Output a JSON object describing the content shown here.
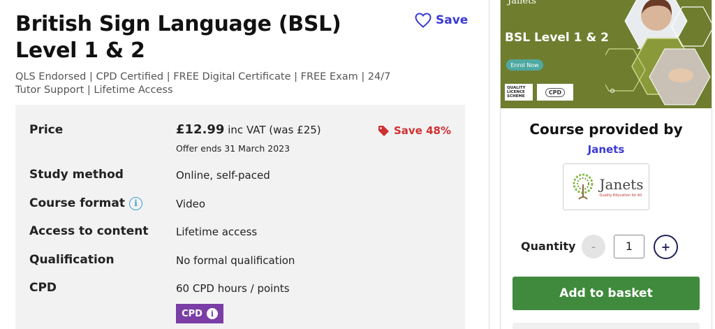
{
  "course": {
    "title": "British Sign Language (BSL) Level 1 & 2",
    "save_label": "Save",
    "subtitle": "QLS Endorsed | CPD Certified | FREE Digital Certificate | FREE Exam | 24/7 Tutor Support | Lifetime Access"
  },
  "details": {
    "price_label": "Price",
    "price_amount": "£12.99",
    "price_suffix": "inc VAT (was £25)",
    "offer_ends": "Offer ends 31 March 2023",
    "save_percent": "Save 48%",
    "study_method_label": "Study method",
    "study_method_value": "Online, self-paced",
    "course_format_label": "Course format",
    "course_format_value": "Video",
    "access_label": "Access to content",
    "access_value": "Lifetime access",
    "qualification_label": "Qualification",
    "qualification_value": "No formal qualification",
    "cpd_label": "CPD",
    "cpd_value": "60 CPD hours / points",
    "cpd_badge": "CPD"
  },
  "sidebar": {
    "banner": {
      "brand": "Janets",
      "title": "BSL Level 1 & 2",
      "pill": "Enrol Now",
      "qls_badge": "QUALITY LICENCE SCHEME",
      "cpd_badge": "CPD",
      "bg_color": "#6f7d2f"
    },
    "provided_by": "Course provided by",
    "provider_name": "Janets",
    "logo_text": "Janets",
    "logo_tagline": "Quality Education for All",
    "quantity_label": "Quantity",
    "quantity_value": "1",
    "minus_symbol": "-",
    "plus_symbol": "+",
    "add_to_basket": "Add to basket"
  },
  "colors": {
    "accent_blue": "#3a3ad6",
    "sale_red": "#d03030",
    "basket_green": "#3f8a3c",
    "cpd_purple": "#7a3ea6"
  }
}
